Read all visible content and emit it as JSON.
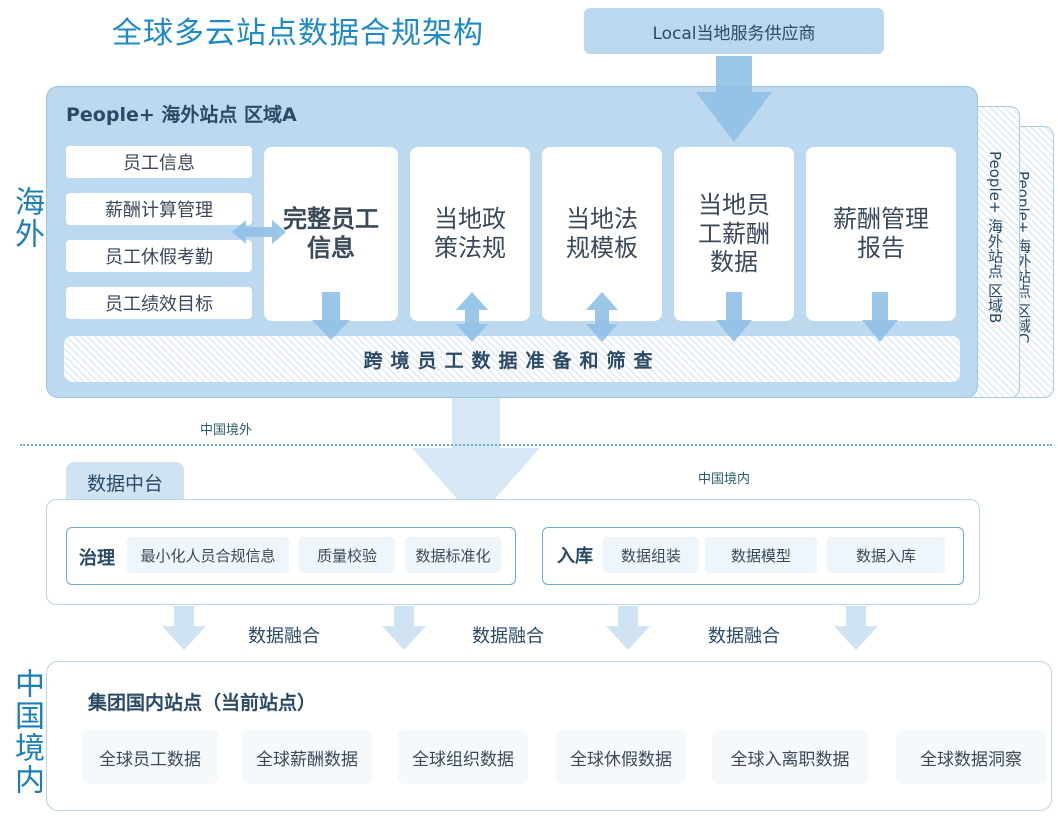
{
  "title": "全球多云站点数据合规架构",
  "supplier": "Local当地服务供应商",
  "side_labels": {
    "overseas": "海外",
    "domestic": "中国境内"
  },
  "region_a": {
    "title": "People+ 海外站点 区域A",
    "left_items": [
      "员工信息",
      "薪酬计算管理",
      "员工休假考勤",
      "员工绩效目标"
    ],
    "boxes": [
      "完整员工信息",
      "当地政策法规",
      "当地法规模板",
      "当地员工薪酬数据",
      "薪酬管理报告"
    ],
    "crossbar": "跨境员工数据准备和筛查"
  },
  "region_b_title": "People+ 海外站点 区域B",
  "region_c_title": "People+ 海外站点 区域C",
  "boundary": {
    "outside": "中国境外",
    "inside": "中国境内"
  },
  "data_platform": {
    "tab": "数据中台",
    "governance": {
      "label": "治理",
      "items": [
        "最小化人员合规信息",
        "质量校验",
        "数据标准化"
      ]
    },
    "storage": {
      "label": "入库",
      "items": [
        "数据组装",
        "数据模型",
        "数据入库"
      ]
    }
  },
  "fusion_labels": [
    "数据融合",
    "数据融合",
    "数据融合"
  ],
  "domestic_site": {
    "title": "集团国内站点（当前站点）",
    "items": [
      "全球员工数据",
      "全球薪酬数据",
      "全球组织数据",
      "全球休假数据",
      "全球入离职数据",
      "全球数据洞察"
    ]
  },
  "colors": {
    "accent": "#1e8ac8",
    "panel": "#bcd9ef",
    "arrow": "#8fc0e6",
    "border": "#b9d5ea"
  }
}
